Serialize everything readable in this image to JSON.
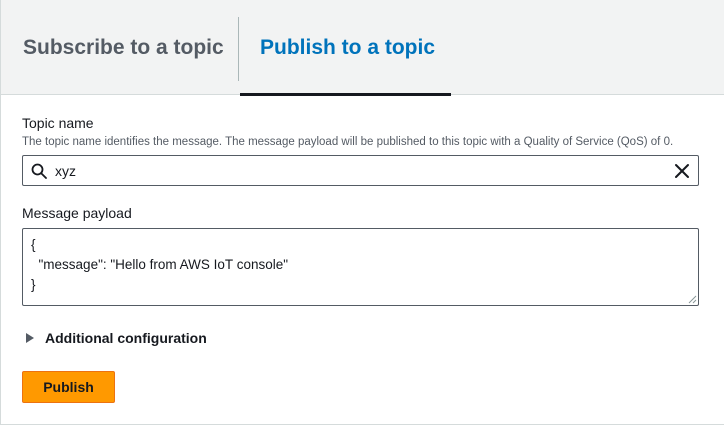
{
  "tabs": [
    {
      "label": "Subscribe to a topic",
      "active": false
    },
    {
      "label": "Publish to a topic",
      "active": true
    }
  ],
  "topic": {
    "label": "Topic name",
    "description": "The topic name identifies the message. The message payload will be published to this topic with a Quality of Service (QoS) of 0.",
    "value": "xyz"
  },
  "payload": {
    "label": "Message payload",
    "value": "{\n  \"message\": \"Hello from AWS IoT console\"\n}"
  },
  "additional": {
    "label": "Additional configuration"
  },
  "publish_button": {
    "label": "Publish"
  },
  "colors": {
    "accent": "#0073bb",
    "button": "#ff9900",
    "tab_bg": "#f2f3f3"
  }
}
